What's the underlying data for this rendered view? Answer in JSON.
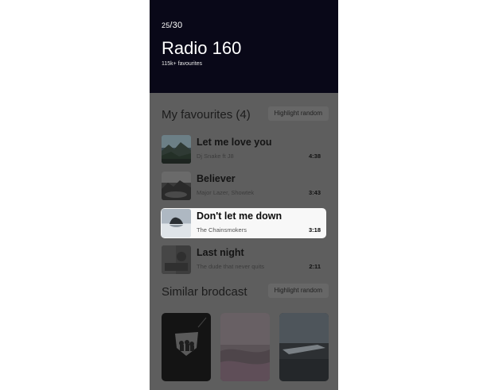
{
  "header": {
    "counter_current": "25",
    "counter_total": "/30",
    "title": "Radio 160",
    "subtitle": "115k+ favourites"
  },
  "favourites": {
    "label": "My favourites (4)",
    "action_label": "Highlight random",
    "tracks": [
      {
        "title": "Let me love you",
        "artist": "Dj Snake ft J8",
        "duration": "4:38",
        "highlighted": false
      },
      {
        "title": "Believer",
        "artist": "Major Lazer, Showtek",
        "duration": "3:43",
        "highlighted": false
      },
      {
        "title": "Don't let me down",
        "artist": "The Chainsmokers",
        "duration": "3:18",
        "highlighted": true
      },
      {
        "title": "Last night",
        "artist": "The dude that never quits",
        "duration": "2:11",
        "highlighted": false
      }
    ]
  },
  "similar": {
    "label": "Similar brodcast",
    "action_label": "Highlight random",
    "cards": [
      {
        "image": "band-silhouette-artwork"
      },
      {
        "image": "pink-abstract-artwork"
      },
      {
        "image": "airplane-wreck-artwork"
      }
    ]
  },
  "colors": {
    "header_bg": "#090818",
    "overlay_bg": "#5e5e5e",
    "highlight_bg": "#f8f8f8"
  }
}
